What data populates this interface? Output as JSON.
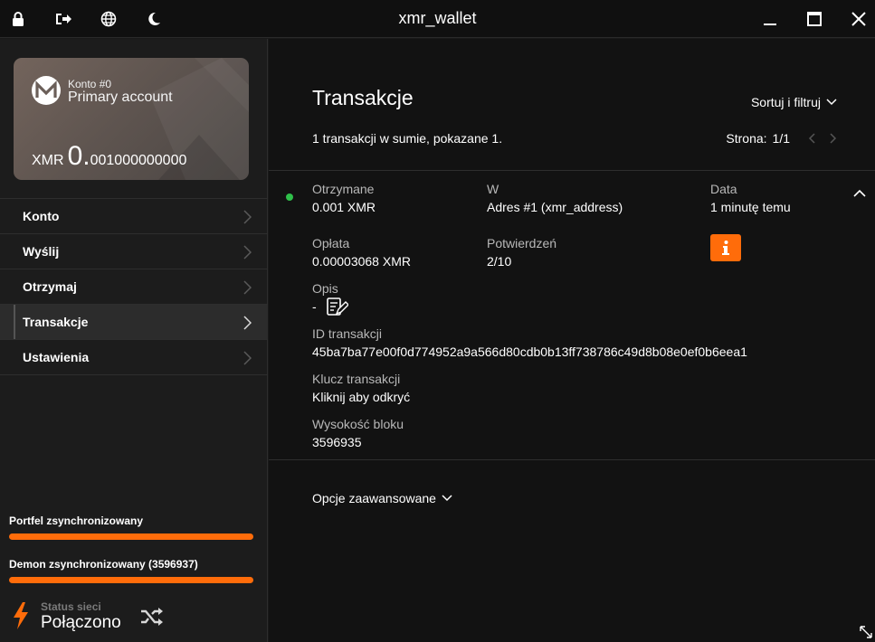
{
  "window": {
    "title": "xmr_wallet"
  },
  "account": {
    "label": "Konto #0",
    "name": "Primary account",
    "currency": "XMR",
    "balance_int": "0.",
    "balance_dec": "001000000000"
  },
  "menu": [
    {
      "label": "Konto"
    },
    {
      "label": "Wyślij"
    },
    {
      "label": "Otrzymaj"
    },
    {
      "label": "Transakcje",
      "active": true
    },
    {
      "label": "Ustawienia"
    }
  ],
  "sync": {
    "wallet_label": "Portfel zsynchronizowany",
    "wallet_progress": 1.0,
    "daemon_label": "Demon zsynchronizowany (3596937)",
    "daemon_progress": 1.0
  },
  "network": {
    "label": "Status sieci",
    "value": "Połączono"
  },
  "page": {
    "title": "Transakcje",
    "sort_label": "Sortuj i filtruj",
    "summary": "1 transakcji w sumie, pokazane 1.",
    "page_label": "Strona:",
    "page_value": "1/1"
  },
  "transaction": {
    "received_label": "Otrzymane",
    "received_value": "0.001 XMR",
    "to_label": "W",
    "to_value": "Adres #1 (xmr_address)",
    "date_label": "Data",
    "date_value": "1 minutę temu",
    "fee_label": "Opłata",
    "fee_value": "0.00003068 XMR",
    "confirmations_label": "Potwierdzeń",
    "confirmations_value": "2/10",
    "description_label": "Opis",
    "description_value": "-",
    "txid_label": "ID transakcji",
    "txid_value": "45ba7ba77e00f0d774952a9a566d80cdb0b13ff738786c49d8b08e0ef0b6eea1",
    "txkey_label": "Klucz transakcji",
    "txkey_value": "Kliknij aby odkryć",
    "height_label": "Wysokość bloku",
    "height_value": "3596935"
  },
  "advanced_label": "Opcje zaawansowane",
  "colors": {
    "accent": "#ff6c0a",
    "status_ok": "#2fc04a"
  }
}
